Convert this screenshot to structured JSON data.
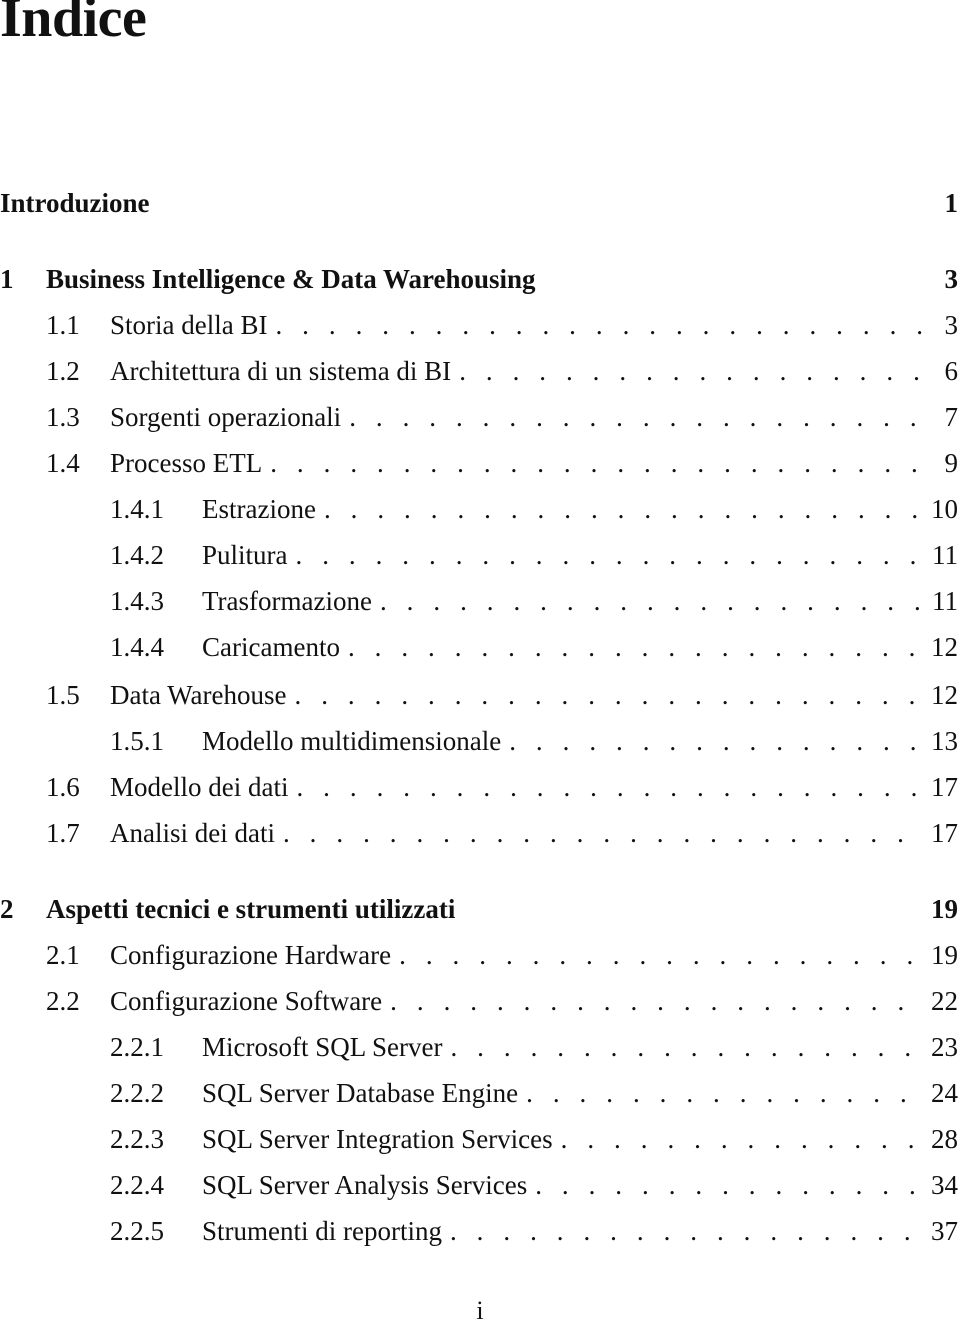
{
  "title": "Indice",
  "entries": [
    {
      "level": "intro",
      "num": "",
      "label": "Introduzione",
      "page": "1"
    },
    {
      "level": "chapter",
      "num": "1",
      "label": "Business Intelligence & Data Warehousing",
      "page": "3"
    },
    {
      "level": "section",
      "num": "1.1",
      "label": "Storia della BI",
      "page": "3"
    },
    {
      "level": "section",
      "num": "1.2",
      "label": "Architettura di un sistema di BI",
      "page": "6"
    },
    {
      "level": "section",
      "num": "1.3",
      "label": "Sorgenti operazionali",
      "page": "7"
    },
    {
      "level": "section",
      "num": "1.4",
      "label": "Processo ETL",
      "page": "9"
    },
    {
      "level": "subsection",
      "num": "1.4.1",
      "label": "Estrazione",
      "page": "10"
    },
    {
      "level": "subsection",
      "num": "1.4.2",
      "label": "Pulitura",
      "page": "11"
    },
    {
      "level": "subsection",
      "num": "1.4.3",
      "label": "Trasformazione",
      "page": "11"
    },
    {
      "level": "subsection",
      "num": "1.4.4",
      "label": "Caricamento",
      "page": "12"
    },
    {
      "level": "section",
      "num": "1.5",
      "label": "Data Warehouse",
      "page": "12"
    },
    {
      "level": "subsection",
      "num": "1.5.1",
      "label": "Modello multidimensionale",
      "page": "13"
    },
    {
      "level": "section",
      "num": "1.6",
      "label": "Modello dei dati",
      "page": "17"
    },
    {
      "level": "section",
      "num": "1.7",
      "label": "Analisi dei dati",
      "page": "17"
    },
    {
      "level": "chapter",
      "num": "2",
      "label": "Aspetti tecnici e strumenti utilizzati",
      "page": "19"
    },
    {
      "level": "section",
      "num": "2.1",
      "label": "Configurazione Hardware",
      "page": "19"
    },
    {
      "level": "section",
      "num": "2.2",
      "label": "Configurazione Software",
      "page": "22"
    },
    {
      "level": "subsection",
      "num": "2.2.1",
      "label": "Microsoft SQL Server",
      "page": "23"
    },
    {
      "level": "subsection",
      "num": "2.2.2",
      "label": "SQL Server Database Engine",
      "page": "24"
    },
    {
      "level": "subsection",
      "num": "2.2.3",
      "label": "SQL Server Integration Services",
      "page": "28"
    },
    {
      "level": "subsection",
      "num": "2.2.4",
      "label": "SQL Server Analysis Services",
      "page": "34"
    },
    {
      "level": "subsection",
      "num": "2.2.5",
      "label": "Strumenti di reporting",
      "page": "37"
    }
  ],
  "page_number": "i"
}
